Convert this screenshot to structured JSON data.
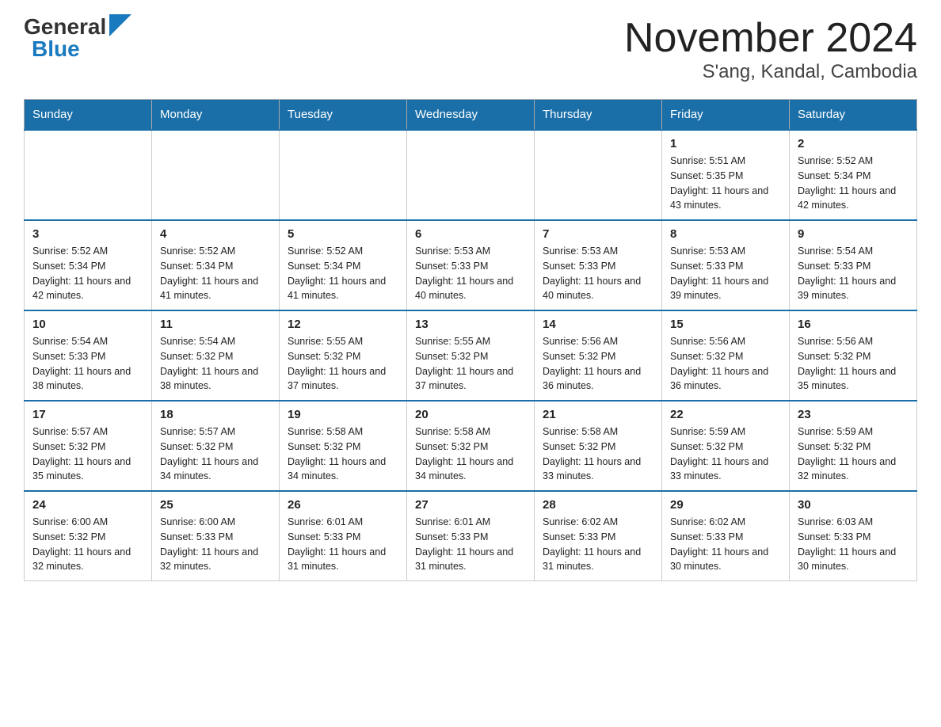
{
  "header": {
    "logo_general": "General",
    "logo_blue": "Blue",
    "title": "November 2024",
    "subtitle": "S'ang, Kandal, Cambodia"
  },
  "days_of_week": [
    "Sunday",
    "Monday",
    "Tuesday",
    "Wednesday",
    "Thursday",
    "Friday",
    "Saturday"
  ],
  "weeks": [
    [
      {
        "day": "",
        "info": ""
      },
      {
        "day": "",
        "info": ""
      },
      {
        "day": "",
        "info": ""
      },
      {
        "day": "",
        "info": ""
      },
      {
        "day": "",
        "info": ""
      },
      {
        "day": "1",
        "info": "Sunrise: 5:51 AM\nSunset: 5:35 PM\nDaylight: 11 hours and 43 minutes."
      },
      {
        "day": "2",
        "info": "Sunrise: 5:52 AM\nSunset: 5:34 PM\nDaylight: 11 hours and 42 minutes."
      }
    ],
    [
      {
        "day": "3",
        "info": "Sunrise: 5:52 AM\nSunset: 5:34 PM\nDaylight: 11 hours and 42 minutes."
      },
      {
        "day": "4",
        "info": "Sunrise: 5:52 AM\nSunset: 5:34 PM\nDaylight: 11 hours and 41 minutes."
      },
      {
        "day": "5",
        "info": "Sunrise: 5:52 AM\nSunset: 5:34 PM\nDaylight: 11 hours and 41 minutes."
      },
      {
        "day": "6",
        "info": "Sunrise: 5:53 AM\nSunset: 5:33 PM\nDaylight: 11 hours and 40 minutes."
      },
      {
        "day": "7",
        "info": "Sunrise: 5:53 AM\nSunset: 5:33 PM\nDaylight: 11 hours and 40 minutes."
      },
      {
        "day": "8",
        "info": "Sunrise: 5:53 AM\nSunset: 5:33 PM\nDaylight: 11 hours and 39 minutes."
      },
      {
        "day": "9",
        "info": "Sunrise: 5:54 AM\nSunset: 5:33 PM\nDaylight: 11 hours and 39 minutes."
      }
    ],
    [
      {
        "day": "10",
        "info": "Sunrise: 5:54 AM\nSunset: 5:33 PM\nDaylight: 11 hours and 38 minutes."
      },
      {
        "day": "11",
        "info": "Sunrise: 5:54 AM\nSunset: 5:32 PM\nDaylight: 11 hours and 38 minutes."
      },
      {
        "day": "12",
        "info": "Sunrise: 5:55 AM\nSunset: 5:32 PM\nDaylight: 11 hours and 37 minutes."
      },
      {
        "day": "13",
        "info": "Sunrise: 5:55 AM\nSunset: 5:32 PM\nDaylight: 11 hours and 37 minutes."
      },
      {
        "day": "14",
        "info": "Sunrise: 5:56 AM\nSunset: 5:32 PM\nDaylight: 11 hours and 36 minutes."
      },
      {
        "day": "15",
        "info": "Sunrise: 5:56 AM\nSunset: 5:32 PM\nDaylight: 11 hours and 36 minutes."
      },
      {
        "day": "16",
        "info": "Sunrise: 5:56 AM\nSunset: 5:32 PM\nDaylight: 11 hours and 35 minutes."
      }
    ],
    [
      {
        "day": "17",
        "info": "Sunrise: 5:57 AM\nSunset: 5:32 PM\nDaylight: 11 hours and 35 minutes."
      },
      {
        "day": "18",
        "info": "Sunrise: 5:57 AM\nSunset: 5:32 PM\nDaylight: 11 hours and 34 minutes."
      },
      {
        "day": "19",
        "info": "Sunrise: 5:58 AM\nSunset: 5:32 PM\nDaylight: 11 hours and 34 minutes."
      },
      {
        "day": "20",
        "info": "Sunrise: 5:58 AM\nSunset: 5:32 PM\nDaylight: 11 hours and 34 minutes."
      },
      {
        "day": "21",
        "info": "Sunrise: 5:58 AM\nSunset: 5:32 PM\nDaylight: 11 hours and 33 minutes."
      },
      {
        "day": "22",
        "info": "Sunrise: 5:59 AM\nSunset: 5:32 PM\nDaylight: 11 hours and 33 minutes."
      },
      {
        "day": "23",
        "info": "Sunrise: 5:59 AM\nSunset: 5:32 PM\nDaylight: 11 hours and 32 minutes."
      }
    ],
    [
      {
        "day": "24",
        "info": "Sunrise: 6:00 AM\nSunset: 5:32 PM\nDaylight: 11 hours and 32 minutes."
      },
      {
        "day": "25",
        "info": "Sunrise: 6:00 AM\nSunset: 5:33 PM\nDaylight: 11 hours and 32 minutes."
      },
      {
        "day": "26",
        "info": "Sunrise: 6:01 AM\nSunset: 5:33 PM\nDaylight: 11 hours and 31 minutes."
      },
      {
        "day": "27",
        "info": "Sunrise: 6:01 AM\nSunset: 5:33 PM\nDaylight: 11 hours and 31 minutes."
      },
      {
        "day": "28",
        "info": "Sunrise: 6:02 AM\nSunset: 5:33 PM\nDaylight: 11 hours and 31 minutes."
      },
      {
        "day": "29",
        "info": "Sunrise: 6:02 AM\nSunset: 5:33 PM\nDaylight: 11 hours and 30 minutes."
      },
      {
        "day": "30",
        "info": "Sunrise: 6:03 AM\nSunset: 5:33 PM\nDaylight: 11 hours and 30 minutes."
      }
    ]
  ]
}
